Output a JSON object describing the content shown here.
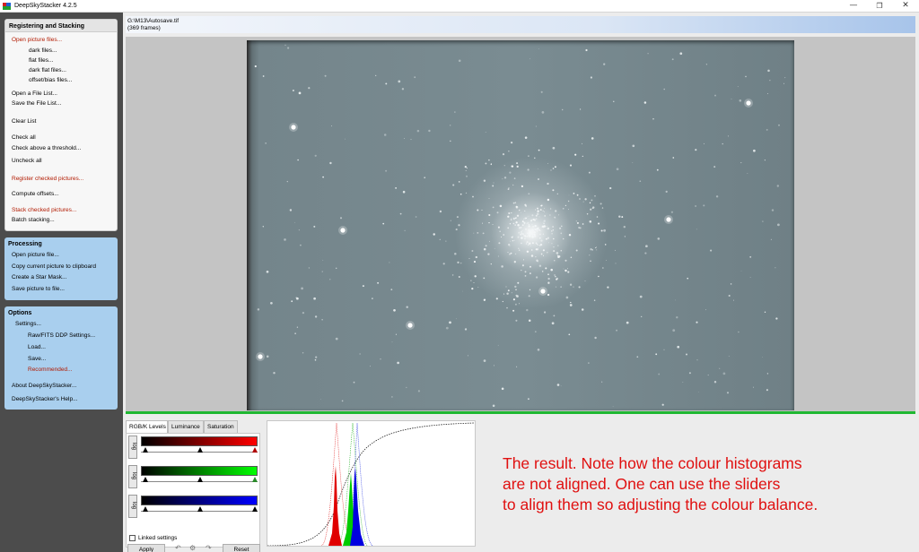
{
  "window": {
    "title": "DeepSkyStacker 4.2.5",
    "minimize_icon": "minimize-icon",
    "maximize_icon": "restore-icon",
    "close_icon": "close-icon"
  },
  "sidebar": {
    "registering": {
      "header": "Registering and Stacking",
      "items": [
        {
          "label": "Open picture files...",
          "accent": true
        },
        {
          "label": "dark files..."
        },
        {
          "label": "flat files..."
        },
        {
          "label": "dark flat files..."
        },
        {
          "label": "offset/bias files..."
        },
        {
          "label": "Open a File List..."
        },
        {
          "label": "Save the File List..."
        },
        {
          "label": "Clear List"
        },
        {
          "label": "Check all"
        },
        {
          "label": "Check above a threshold..."
        },
        {
          "label": "Uncheck all"
        },
        {
          "label": "Register checked pictures...",
          "accent": true
        },
        {
          "label": "Compute offsets..."
        },
        {
          "label": "Stack checked pictures...",
          "accent": true
        },
        {
          "label": "Batch stacking..."
        }
      ]
    },
    "processing": {
      "header": "Processing",
      "items": [
        {
          "label": "Open picture file..."
        },
        {
          "label": "Copy current picture to clipboard"
        },
        {
          "label": "Create a Star Mask..."
        },
        {
          "label": "Save picture to file..."
        }
      ]
    },
    "options": {
      "header": "Options",
      "items": [
        {
          "label": "Settings..."
        },
        {
          "label": "Raw/FITS DDP Settings..."
        },
        {
          "label": "Load..."
        },
        {
          "label": "Save..."
        },
        {
          "label": "Recommended...",
          "accent": true
        },
        {
          "label": "About DeepSkyStacker..."
        },
        {
          "label": "DeepSkyStacker's Help..."
        }
      ]
    }
  },
  "file": {
    "path": "G:\\M13\\Autosave.tif",
    "frames": "(369 frames)"
  },
  "levels": {
    "tabs": [
      "RGB/K Levels",
      "Luminance",
      "Saturation"
    ],
    "log_label": "log",
    "linked_settings": "Linked settings",
    "apply_label": "Apply",
    "reset_label": "Reset",
    "undo_icon": "undo-icon",
    "settings_icon": "settings-icon",
    "redo_icon": "redo-icon"
  },
  "annotation": {
    "lines": [
      "The result. Note how the colour histograms",
      "are not aligned.  One can use the sliders",
      "to align them so adjusting the colour balance."
    ]
  },
  "colors": {
    "accent_red": "#b21a00",
    "panel_blue": "#a9cfee",
    "progress_green": "#1fb832",
    "annotation_red": "#e01010"
  }
}
